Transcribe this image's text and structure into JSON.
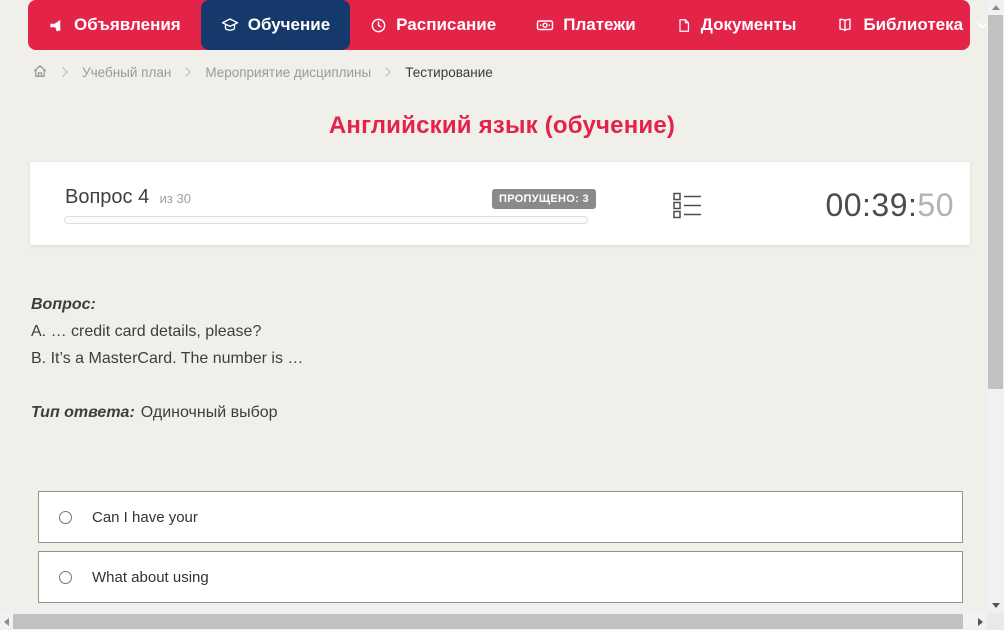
{
  "nav": {
    "items": [
      {
        "label": "Объявления",
        "icon": "megaphone-icon",
        "active": false
      },
      {
        "label": "Обучение",
        "icon": "graduation-cap-icon",
        "active": true
      },
      {
        "label": "Расписание",
        "icon": "clock-icon",
        "active": false
      },
      {
        "label": "Платежи",
        "icon": "cash-icon",
        "active": false
      },
      {
        "label": "Документы",
        "icon": "document-icon",
        "active": false
      },
      {
        "label": "Библиотека",
        "icon": "book-icon",
        "active": false,
        "has_dropdown": true
      }
    ]
  },
  "breadcrumb": {
    "home_icon": "home-icon",
    "items": [
      "Учебный план",
      "Мероприятие дисциплины",
      "Тестирование"
    ]
  },
  "page": {
    "title": "Английский язык (обучение)"
  },
  "quiz": {
    "question_number_label": "Вопрос 4",
    "question_total_label": "из 30",
    "skipped_badge": "ПРОПУЩЕНО: 3",
    "progress_percent": 0,
    "timer_main": "00:39:",
    "timer_seconds": "50",
    "question_heading": "Вопрос:",
    "question_line_a": "A. … credit card details, please?",
    "question_line_b": "B. It’s a MasterCard. The number is …",
    "answer_type_label": "Тип ответа:",
    "answer_type_value": "Одиночный выбор",
    "options": [
      {
        "label": "Can I have your",
        "selected": false
      },
      {
        "label": "What about using",
        "selected": false
      }
    ]
  },
  "colors": {
    "nav_red": "#e42348",
    "active_tab_navy": "#16396b",
    "title_red": "#e4224a",
    "badge_gray": "#8a8a8a",
    "page_bg": "#f1efe9"
  }
}
